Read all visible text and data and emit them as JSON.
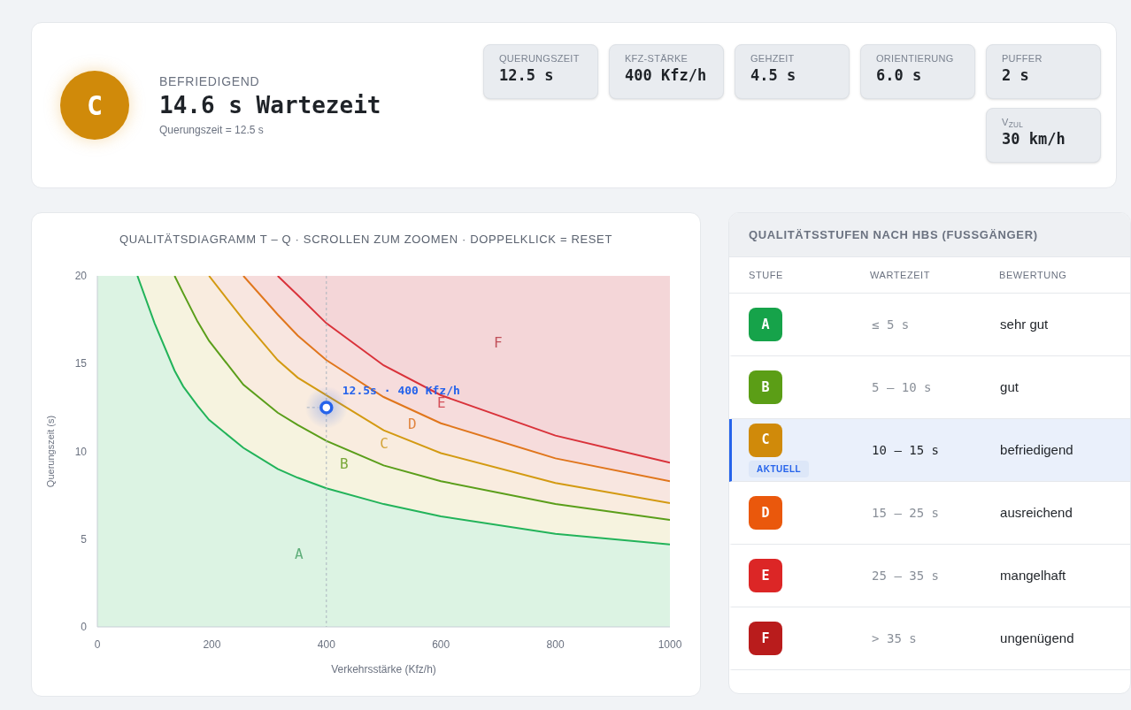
{
  "summary": {
    "grade": "C",
    "rating": "BEFRIEDIGEND",
    "headline": "14.6 s Wartezeit",
    "subline": "Querungszeit = 12.5 s"
  },
  "stats": [
    {
      "label": "QUERUNGSZEIT",
      "value": "12.5 s"
    },
    {
      "label": "KFZ-STÄRKE",
      "value": "400 Kfz/h"
    },
    {
      "label": "GEHZEIT",
      "value": "4.5 s"
    },
    {
      "label": "ORIENTIERUNG",
      "value": "6.0 s"
    },
    {
      "label": "PUFFER",
      "value": "2 s"
    },
    {
      "label": "V$_{ZUL}$",
      "value": "30 km/h"
    }
  ],
  "chart": {
    "title": "QUALITÄTSDIAGRAMM T – Q · SCROLLEN ZUM ZOOMEN · DOPPELKLICK = RESET",
    "chart_data": {
      "type": "line",
      "xlabel": "Verkehrsstärke (Kfz/h)",
      "ylabel": "Querungszeit (s)",
      "x": [
        70,
        100,
        135,
        150,
        175,
        195,
        255,
        315,
        350,
        400,
        500,
        600,
        800,
        1000
      ],
      "xlim": [
        0,
        1000
      ],
      "ylim": [
        0,
        20
      ],
      "xticks": [
        0,
        200,
        400,
        600,
        800,
        1000
      ],
      "yticks": [
        0,
        5,
        10,
        15,
        20
      ],
      "series": [
        {
          "color": "#22b35a",
          "values": [
            20,
            17.3,
            14.6,
            13.7,
            12.6,
            11.8,
            10.2,
            9.0,
            8.5,
            7.9,
            7.0,
            6.3,
            5.3,
            4.7
          ]
        },
        {
          "color": "#5a9e1a",
          "values": [
            null,
            null,
            20,
            19.0,
            17.4,
            16.3,
            13.8,
            12.2,
            11.5,
            10.6,
            9.2,
            8.3,
            7.0,
            6.1
          ]
        },
        {
          "color": "#d39a12",
          "values": [
            null,
            null,
            null,
            null,
            null,
            20,
            17.5,
            15.2,
            14.2,
            null,
            11.2,
            9.9,
            8.2,
            7.05
          ]
        },
        {
          "color": "#e0761c",
          "values": [
            null,
            null,
            null,
            null,
            null,
            null,
            20,
            17.8,
            16.6,
            15.2,
            13.1,
            11.6,
            9.6,
            8.3
          ]
        },
        {
          "color": "#d9323a",
          "values": [
            null,
            null,
            null,
            null,
            null,
            null,
            null,
            20,
            18.9,
            17.3,
            14.9,
            13.2,
            10.9,
            9.35
          ]
        },
        {
          "name": "12.5s · 400 Kfz/h",
          "color": "#2563eb",
          "marker": true,
          "values": [
            null,
            null,
            null,
            null,
            null,
            null,
            null,
            null,
            null,
            12.5,
            null,
            null,
            null,
            null
          ]
        }
      ],
      "annotations": [
        "A",
        "B",
        "C",
        "D",
        "E",
        "F"
      ]
    }
  },
  "table": {
    "title": "QUALITÄTSSTUFEN NACH HBS (FUSSGÄNGER)",
    "columns": [
      "STUFE",
      "WARTEZEIT",
      "BEWERTUNG"
    ],
    "current_badge": "AKTUELL",
    "rows": [
      {
        "grade": "A",
        "color": "#16a34a",
        "wait": "≤ 5 s",
        "rating": "sehr gut",
        "selected": false
      },
      {
        "grade": "B",
        "color": "#5b9e16",
        "wait": "5 – 10 s",
        "rating": "gut",
        "selected": false
      },
      {
        "grade": "C",
        "color": "#d08a0a",
        "wait": "10 – 15 s",
        "rating": "befriedigend",
        "selected": true
      },
      {
        "grade": "D",
        "color": "#ea580c",
        "wait": "15 – 25 s",
        "rating": "ausreichend",
        "selected": false
      },
      {
        "grade": "E",
        "color": "#dc2626",
        "wait": "25 – 35 s",
        "rating": "mangelhaft",
        "selected": false
      },
      {
        "grade": "F",
        "color": "#b91c1c",
        "wait": "> 35 s",
        "rating": "ungenügend",
        "selected": false
      }
    ]
  }
}
